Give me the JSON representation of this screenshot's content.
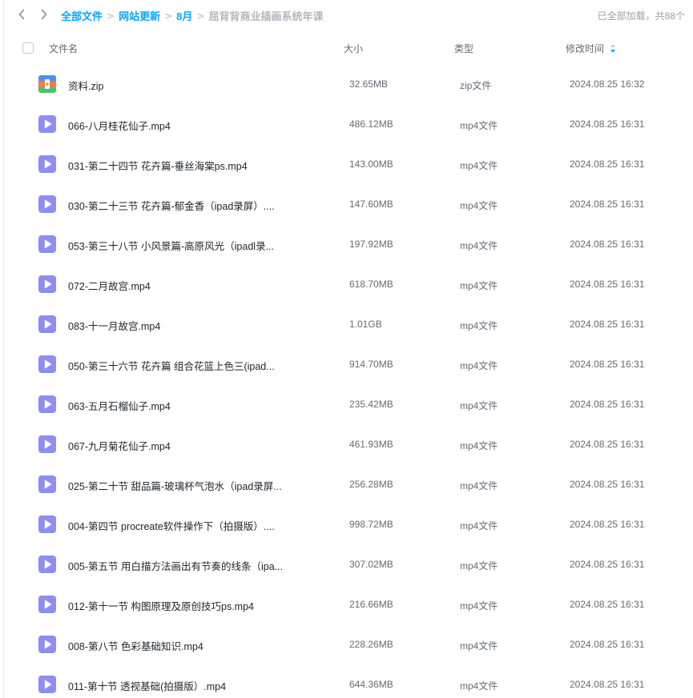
{
  "breadcrumb": {
    "items": [
      "全部文件",
      "网站更新",
      "8月"
    ],
    "current": "屈背背商业插画系统年课",
    "separator": ">"
  },
  "status": {
    "load_text": "已全部加载，共88个"
  },
  "columns": {
    "name": "文件名",
    "size": "大小",
    "type": "类型",
    "time": "修改时间"
  },
  "colors": {
    "accent": "#06a7ff",
    "video_icon": "#8d8df2"
  },
  "files": [
    {
      "icon": "zip-icon",
      "name": "资料.zip",
      "size": "32.65MB",
      "type": "zip文件",
      "time": "2024.08.25 16:32"
    },
    {
      "icon": "video-icon",
      "name": "066-八月桂花仙子.mp4",
      "size": "486.12MB",
      "type": "mp4文件",
      "time": "2024.08.25 16:31"
    },
    {
      "icon": "video-icon",
      "name": "031-第二十四节 花卉篇-垂丝海棠ps.mp4",
      "size": "143.00MB",
      "type": "mp4文件",
      "time": "2024.08.25 16:31"
    },
    {
      "icon": "video-icon",
      "name": "030-第二十三节 花卉篇-郁金香（ipad录屏）....",
      "size": "147.60MB",
      "type": "mp4文件",
      "time": "2024.08.25 16:31"
    },
    {
      "icon": "video-icon",
      "name": "053-第三十八节 小风景篇-高原风光（ipadl录...",
      "size": "197.92MB",
      "type": "mp4文件",
      "time": "2024.08.25 16:31"
    },
    {
      "icon": "video-icon",
      "name": "072-二月故宫.mp4",
      "size": "618.70MB",
      "type": "mp4文件",
      "time": "2024.08.25 16:31"
    },
    {
      "icon": "video-icon",
      "name": "083-十一月故宫.mp4",
      "size": "1.01GB",
      "type": "mp4文件",
      "time": "2024.08.25 16:31"
    },
    {
      "icon": "video-icon",
      "name": "050-第三十六节 花卉篇 组合花篮上色三(ipad...",
      "size": "914.70MB",
      "type": "mp4文件",
      "time": "2024.08.25 16:31"
    },
    {
      "icon": "video-icon",
      "name": "063-五月石榴仙子.mp4",
      "size": "235.42MB",
      "type": "mp4文件",
      "time": "2024.08.25 16:31"
    },
    {
      "icon": "video-icon",
      "name": "067-九月菊花仙子.mp4",
      "size": "461.93MB",
      "type": "mp4文件",
      "time": "2024.08.25 16:31"
    },
    {
      "icon": "video-icon",
      "name": "025-第二十节 甜品篇-玻璃杯气泡水（ipad录屏...",
      "size": "256.28MB",
      "type": "mp4文件",
      "time": "2024.08.25 16:31"
    },
    {
      "icon": "video-icon",
      "name": "004-第四节 procreate软件操作下（拍摄版）....",
      "size": "998.72MB",
      "type": "mp4文件",
      "time": "2024.08.25 16:31"
    },
    {
      "icon": "video-icon",
      "name": "005-第五节 用白描方法画出有节奏的线条（ipa...",
      "size": "307.02MB",
      "type": "mp4文件",
      "time": "2024.08.25 16:31"
    },
    {
      "icon": "video-icon",
      "name": "012-第十一节 构图原理及原创技巧ps.mp4",
      "size": "216.66MB",
      "type": "mp4文件",
      "time": "2024.08.25 16:31"
    },
    {
      "icon": "video-icon",
      "name": "008-第八节 色彩基础知识.mp4",
      "size": "228.26MB",
      "type": "mp4文件",
      "time": "2024.08.25 16:31"
    },
    {
      "icon": "video-icon",
      "name": "011-第十节 透视基础(拍摄版）.mp4",
      "size": "644.36MB",
      "type": "mp4文件",
      "time": "2024.08.25 16:31"
    }
  ]
}
